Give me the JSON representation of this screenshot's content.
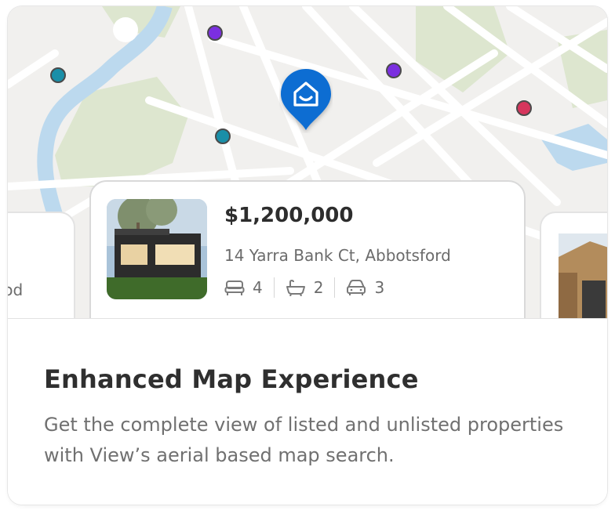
{
  "map": {
    "marker_colors": {
      "teal": "#1a8fa8",
      "purple": "#7b2fe0",
      "red": "#d6365d",
      "pin": "#0a6dd2"
    },
    "pin_icon": "house-smile-icon"
  },
  "listing": {
    "price": "$1,200,000",
    "address": "14 Yarra Bank Ct, Abbotsford",
    "beds": "4",
    "baths": "2",
    "cars": "3"
  },
  "side_listing_left": {
    "partial_text": "ood"
  },
  "feature": {
    "title": "Enhanced Map Experience",
    "description": "Get the complete view of listed and unlisted properties with View’s aerial based map search."
  }
}
